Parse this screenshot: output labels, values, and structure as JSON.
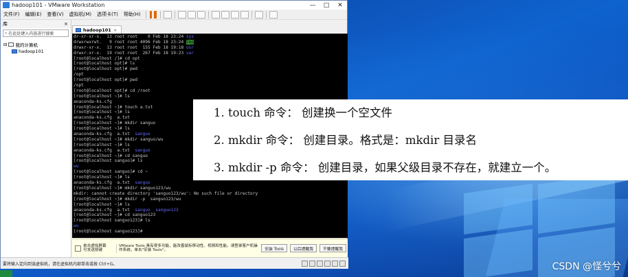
{
  "window": {
    "title": "hadoop101 - VMware Workstation",
    "min": "—",
    "max": "□",
    "close": "✕"
  },
  "menu": [
    "文件(F)",
    "编辑(E)",
    "查看(V)",
    "虚拟机(M)",
    "选项卡(T)",
    "帮助(H)"
  ],
  "library": {
    "header": "库",
    "close": "×",
    "search_placeholder": "在此处键入内容进行搜索",
    "root": "我的计算机",
    "vm": "hadoop101"
  },
  "tab": {
    "label": "hadoop101",
    "close": "×"
  },
  "console_lines": [
    [
      "dr-xr-xr-x.  13 root root    0 Feb 18 23:24 ",
      "sys",
      "blue"
    ],
    [
      "drwxrwxrwt.   9 root root 4096 Feb 18 23:24 ",
      "tmp",
      "hl"
    ],
    [
      "drwxr-xr-x.  13 root root  155 Feb 18 19:18 ",
      "usr",
      "blue"
    ],
    [
      "drwxr-xr-x.  19 root root  267 Feb 18 19:23 ",
      "var",
      "blue"
    ],
    [
      "[root@localhost /]# cd opt",
      "",
      ""
    ],
    [
      "[root@localhost opt]# ls",
      "",
      ""
    ],
    [
      "[root@localhost opt]# pwd",
      "",
      ""
    ],
    [
      "/opt",
      "",
      ""
    ],
    [
      "[root@localhost opt]# pwd",
      "",
      ""
    ],
    [
      "/opt",
      "",
      ""
    ],
    [
      "[root@localhost opt]# cd /root",
      "",
      ""
    ],
    [
      "[root@localhost ~]# ls",
      "",
      ""
    ],
    [
      "anaconda-ks.cfg",
      "",
      ""
    ],
    [
      "[root@localhost ~]# touch a.txt",
      "",
      ""
    ],
    [
      "[root@localhost ~]# ls",
      "",
      ""
    ],
    [
      "anaconda-ks.cfg  a.txt",
      "",
      ""
    ],
    [
      "[root@localhost ~]# mkdir sanguo",
      "",
      ""
    ],
    [
      "[root@localhost ~]# ls",
      "",
      ""
    ],
    [
      "anaconda-ks.cfg  a.txt  ",
      "sanguo",
      "blue"
    ],
    [
      "[root@localhost ~]# mkdir sanguo/wu",
      "",
      ""
    ],
    [
      "[root@localhost ~]# ls",
      "",
      ""
    ],
    [
      "anaconda-ks.cfg  a.txt  ",
      "sanguo",
      "blue"
    ],
    [
      "[root@localhost ~]# cd sanguo",
      "",
      ""
    ],
    [
      "[root@localhost sanguo]# ls",
      "",
      ""
    ],
    [
      "",
      "wu",
      "blue"
    ],
    [
      "[root@localhost sanguo]# cd ~",
      "",
      ""
    ],
    [
      "[root@localhost ~]# ls",
      "",
      ""
    ],
    [
      "anaconda-ks.cfg  a.txt  ",
      "sanguo",
      "blue"
    ],
    [
      "[root@localhost ~]# mkdir sanguo123/wu",
      "",
      ""
    ],
    [
      "mkdir: cannot create directory 'sanguo123/wu': No such file or directory",
      "",
      ""
    ],
    [
      "[root@localhost ~]# mkdir -p  sanguo123/wu",
      "",
      ""
    ],
    [
      "[root@localhost ~]# ls",
      "",
      ""
    ],
    [
      "anaconda-ks.cfg  a.txt  ",
      "sanguo  sanguo123",
      "blue"
    ],
    [
      "[root@localhost ~]# cd sanguo123",
      "",
      ""
    ],
    [
      "[root@localhost sanguo123]# ls",
      "",
      ""
    ],
    [
      "",
      "wu",
      "blue"
    ],
    [
      "[root@localhost sanguo123]#",
      "",
      ""
    ]
  ],
  "hint": {
    "left": "单击虚拟屏幕\n可发送按键",
    "text": "VMware Tools 具有很多功能，能改善鼠标移动性、视频和性能。请登录客户机操作系统，单击\"安装 Tools\"。",
    "install": "安装 Tools",
    "later": "以后提醒我",
    "never": "不要提醒我"
  },
  "status": "要将输入定向到该虚拟机，请在虚拟机内部单击或按 Ctrl+G。",
  "callout": [
    "1. touch 命令： 创建换一个空文件",
    "2. mkdir 命令： 创建目录。格式是：mkdir 目录名",
    "3. mkdir -p 命令： 创建目录，如果父级目录不存在，就建立一个。"
  ],
  "watermark": "CSDN @怪兮兮"
}
